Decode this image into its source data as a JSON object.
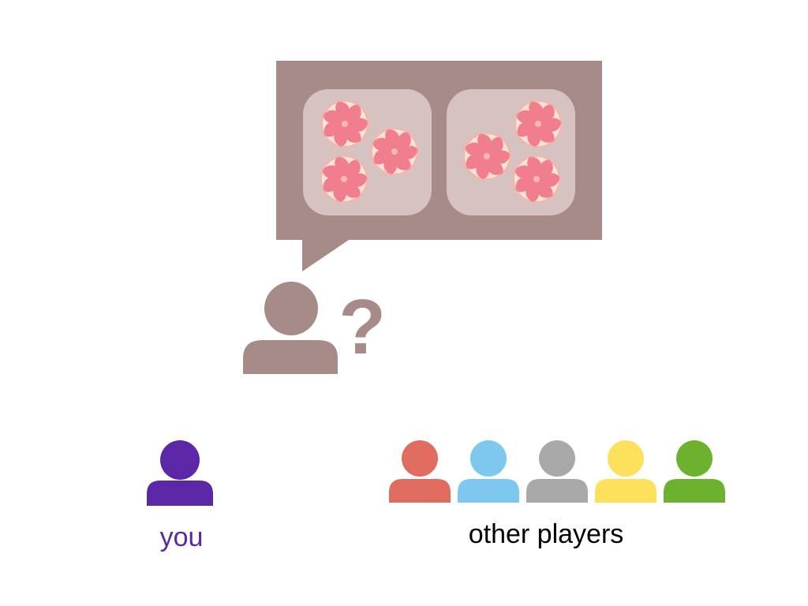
{
  "palette": {
    "bubble": "#a68b88",
    "option_box": "#d6c2c0",
    "thinker": "#a68b88",
    "you": "#5b27a6",
    "other_players": [
      "#e06b5f",
      "#7ec8ef",
      "#a8a8a8",
      "#fde05c",
      "#6db22e"
    ],
    "candy_pink": "#f07e8d",
    "candy_light": "#fde3dd"
  },
  "icons": {
    "thinker": "person-icon",
    "question": "question-mark-icon",
    "candy": "swirl-candy-icon"
  },
  "speech_bubble": {
    "options": [
      {
        "candy_count": 3
      },
      {
        "candy_count": 3
      }
    ]
  },
  "thinker": {
    "question_mark": "?"
  },
  "you": {
    "label": "you"
  },
  "other_players": {
    "label": "other players",
    "count": 5
  }
}
